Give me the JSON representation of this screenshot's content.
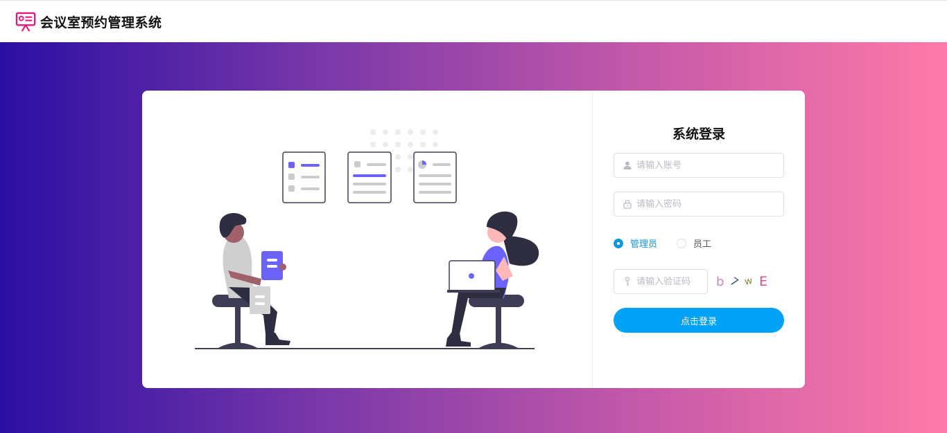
{
  "header": {
    "app_title": "会议室预约管理系统",
    "logo_icon": "presentation-board-icon",
    "logo_color": "#e4187a"
  },
  "login": {
    "title": "系统登录",
    "username": {
      "placeholder": "请输入账号",
      "value": "",
      "icon": "user-icon"
    },
    "password": {
      "placeholder": "请输入密码",
      "value": "",
      "icon": "lock-icon"
    },
    "roles": [
      {
        "label": "管理员",
        "checked": true
      },
      {
        "label": "员工",
        "checked": false
      }
    ],
    "captcha_input": {
      "placeholder": "请输入验证码",
      "value": "",
      "icon": "key-icon"
    },
    "captcha_chars": [
      "b",
      "7",
      "w",
      "E"
    ],
    "submit_label": "点击登录",
    "accent_color": "#00a2f5",
    "selected_color": "#1296db"
  },
  "background": {
    "gradient_colors": [
      "#2b0fa3",
      "#7c39a9",
      "#c65aa9",
      "#ff7aa8"
    ]
  }
}
